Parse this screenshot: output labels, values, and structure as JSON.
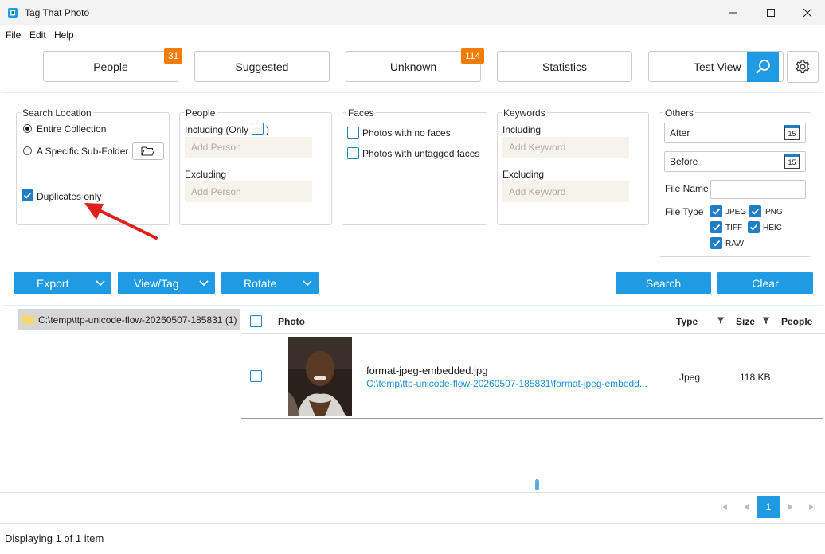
{
  "window": {
    "title": "Tag That Photo"
  },
  "menu": [
    "File",
    "Edit",
    "Help"
  ],
  "tabs": {
    "people": {
      "label": "People",
      "badge": "31"
    },
    "suggested": {
      "label": "Suggested"
    },
    "unknown": {
      "label": "Unknown",
      "badge": "114"
    },
    "statistics": {
      "label": "Statistics"
    },
    "test_view": {
      "label": "Test View"
    }
  },
  "search_location": {
    "title": "Search Location",
    "entire_collection": "Entire Collection",
    "specific_folder": "A Specific Sub-Folder",
    "duplicates_only": "Duplicates only"
  },
  "people_filter": {
    "title": "People",
    "including": "Including (Only",
    "including_close": ")",
    "excluding": "Excluding",
    "add_person_placeholder": "Add Person"
  },
  "faces_filter": {
    "title": "Faces",
    "no_faces": "Photos with no faces",
    "untagged_faces": "Photos with untagged faces"
  },
  "keywords_filter": {
    "title": "Keywords",
    "including": "Including",
    "excluding": "Excluding",
    "add_keyword_placeholder": "Add Keyword"
  },
  "others_filter": {
    "title": "Others",
    "after": "After",
    "before": "Before",
    "file_name": "File Name",
    "file_type": "File Type",
    "calendar_day": "15",
    "types": {
      "jpeg": "JPEG",
      "png": "PNG",
      "tiff": "TIFF",
      "heic": "HEIC",
      "raw": "RAW"
    }
  },
  "actions": {
    "export": "Export",
    "view_tag": "View/Tag",
    "rotate": "Rotate",
    "search": "Search",
    "clear": "Clear"
  },
  "folder_tree": {
    "item": "C:\\temp\\ttp-unicode-flow-20260507-185831 (1)"
  },
  "grid": {
    "columns": {
      "photo": "Photo",
      "type": "Type",
      "size": "Size",
      "people": "People"
    },
    "rows": [
      {
        "filename": "format-jpeg-embedded.jpg",
        "path": "C:\\temp\\ttp-unicode-flow-20260507-185831\\format-jpeg-embedd...",
        "type": "Jpeg",
        "size": "118 KB"
      }
    ]
  },
  "pager": {
    "current_page": "1"
  },
  "status": {
    "text": "Displaying 1 of 1 item"
  },
  "colors": {
    "accent": "#1e9be3",
    "badge": "#f57c00",
    "checkbox": "#1e7fc4",
    "annotation_arrow": "#e0201b"
  }
}
